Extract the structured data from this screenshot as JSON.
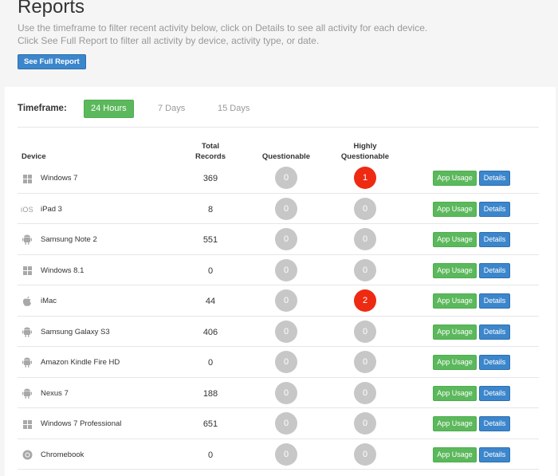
{
  "header": {
    "title": "Reports",
    "intro_line1": "Use the timeframe to filter recent activity below, click on Details to see all activity for each device.",
    "intro_line2": "Click See Full Report to filter all activity by device, activity type, or date.",
    "full_report_label": "See Full Report"
  },
  "timeframe": {
    "label": "Timeframe:",
    "options": [
      "24 Hours",
      "7 Days",
      "15 Days"
    ],
    "selected": "24 Hours"
  },
  "table": {
    "headers": {
      "device": "Device",
      "total_line1": "Total",
      "total_line2": "Records",
      "questionable": "Questionable",
      "highly_line1": "Highly",
      "highly_line2": "Questionable"
    },
    "app_usage_label": "App Usage",
    "details_label": "Details",
    "rows": [
      {
        "icon": "windows-icon",
        "device": "Windows 7",
        "records": "369",
        "questionable": "0",
        "highly": "1"
      },
      {
        "icon": "ios-icon",
        "device": "iPad 3",
        "records": "8",
        "questionable": "0",
        "highly": "0"
      },
      {
        "icon": "android-icon",
        "device": "Samsung Note 2",
        "records": "551",
        "questionable": "0",
        "highly": "0"
      },
      {
        "icon": "windows-icon",
        "device": "Windows 8.1",
        "records": "0",
        "questionable": "0",
        "highly": "0"
      },
      {
        "icon": "apple-icon",
        "device": "iMac",
        "records": "44",
        "questionable": "0",
        "highly": "2"
      },
      {
        "icon": "android-icon",
        "device": "Samsung Galaxy S3",
        "records": "406",
        "questionable": "0",
        "highly": "0"
      },
      {
        "icon": "android-icon",
        "device": "Amazon Kindle Fire HD",
        "records": "0",
        "questionable": "0",
        "highly": "0"
      },
      {
        "icon": "android-icon",
        "device": "Nexus 7",
        "records": "188",
        "questionable": "0",
        "highly": "0"
      },
      {
        "icon": "windows-icon",
        "device": "Windows 7 Professional",
        "records": "651",
        "questionable": "0",
        "highly": "0"
      },
      {
        "icon": "chrome-icon",
        "device": "Chromebook",
        "records": "0",
        "questionable": "0",
        "highly": "0"
      }
    ]
  },
  "colors": {
    "green": "#5cb85c",
    "blue": "#3c86cc",
    "red": "#ee2a13",
    "grey_circle": "#c7c7c7"
  }
}
